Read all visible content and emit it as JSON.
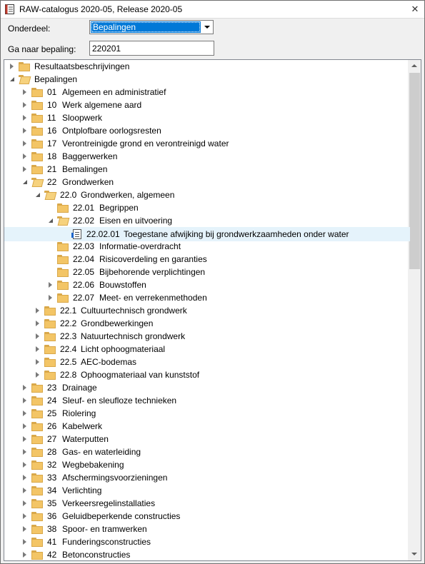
{
  "window": {
    "title": "RAW-catalogus 2020-05, Release 2020-05"
  },
  "form": {
    "onderdeel_label": "Onderdeel:",
    "onderdeel_value": "Bepalingen",
    "ganaar_label": "Ga naar bepaling:",
    "ganaar_value": "220201"
  },
  "tree": [
    {
      "code": "Resultaatsbeschrijvingen",
      "name": "",
      "level": 0,
      "exp": "c",
      "icon": "folder"
    },
    {
      "code": "Bepalingen",
      "name": "",
      "level": 0,
      "exp": "o",
      "icon": "folder-open"
    },
    {
      "code": "01",
      "name": "Algemeen en administratief",
      "level": 1,
      "exp": "c",
      "icon": "folder"
    },
    {
      "code": "10",
      "name": "Werk algemene aard",
      "level": 1,
      "exp": "c",
      "icon": "folder"
    },
    {
      "code": "11",
      "name": "Sloopwerk",
      "level": 1,
      "exp": "c",
      "icon": "folder"
    },
    {
      "code": "16",
      "name": "Ontplofbare oorlogsresten",
      "level": 1,
      "exp": "c",
      "icon": "folder"
    },
    {
      "code": "17",
      "name": "Verontreinigde grond en verontreinigd water",
      "level": 1,
      "exp": "c",
      "icon": "folder"
    },
    {
      "code": "18",
      "name": "Baggerwerken",
      "level": 1,
      "exp": "c",
      "icon": "folder"
    },
    {
      "code": "21",
      "name": "Bemalingen",
      "level": 1,
      "exp": "c",
      "icon": "folder"
    },
    {
      "code": "22",
      "name": "Grondwerken",
      "level": 1,
      "exp": "o",
      "icon": "folder-open"
    },
    {
      "code": "22.0",
      "name": "Grondwerken, algemeen",
      "level": 2,
      "exp": "o",
      "icon": "folder-open"
    },
    {
      "code": "22.01",
      "name": "Begrippen",
      "level": 3,
      "exp": "",
      "icon": "folder"
    },
    {
      "code": "22.02",
      "name": "Eisen en uitvoering",
      "level": 3,
      "exp": "o",
      "icon": "folder-open"
    },
    {
      "code": "22.02.01",
      "name": "Toegestane afwijking bij grondwerkzaamheden onder water",
      "level": 4,
      "exp": "",
      "icon": "doc",
      "selected": true
    },
    {
      "code": "22.03",
      "name": "Informatie-overdracht",
      "level": 3,
      "exp": "",
      "icon": "folder"
    },
    {
      "code": "22.04",
      "name": "Risicoverdeling en garanties",
      "level": 3,
      "exp": "",
      "icon": "folder"
    },
    {
      "code": "22.05",
      "name": "Bijbehorende verplichtingen",
      "level": 3,
      "exp": "",
      "icon": "folder"
    },
    {
      "code": "22.06",
      "name": "Bouwstoffen",
      "level": 3,
      "exp": "c",
      "icon": "folder"
    },
    {
      "code": "22.07",
      "name": "Meet- en verrekenmethoden",
      "level": 3,
      "exp": "c",
      "icon": "folder"
    },
    {
      "code": "22.1",
      "name": "Cultuurtechnisch grondwerk",
      "level": 2,
      "exp": "c",
      "icon": "folder"
    },
    {
      "code": "22.2",
      "name": "Grondbewerkingen",
      "level": 2,
      "exp": "c",
      "icon": "folder"
    },
    {
      "code": "22.3",
      "name": "Natuurtechnisch grondwerk",
      "level": 2,
      "exp": "c",
      "icon": "folder"
    },
    {
      "code": "22.4",
      "name": "Licht ophoogmateriaal",
      "level": 2,
      "exp": "c",
      "icon": "folder"
    },
    {
      "code": "22.5",
      "name": "AEC-bodemas",
      "level": 2,
      "exp": "c",
      "icon": "folder"
    },
    {
      "code": "22.8",
      "name": "Ophoogmateriaal van kunststof",
      "level": 2,
      "exp": "c",
      "icon": "folder"
    },
    {
      "code": "23",
      "name": "Drainage",
      "level": 1,
      "exp": "c",
      "icon": "folder"
    },
    {
      "code": "24",
      "name": "Sleuf- en sleufloze technieken",
      "level": 1,
      "exp": "c",
      "icon": "folder"
    },
    {
      "code": "25",
      "name": "Riolering",
      "level": 1,
      "exp": "c",
      "icon": "folder"
    },
    {
      "code": "26",
      "name": "Kabelwerk",
      "level": 1,
      "exp": "c",
      "icon": "folder"
    },
    {
      "code": "27",
      "name": "Waterputten",
      "level": 1,
      "exp": "c",
      "icon": "folder"
    },
    {
      "code": "28",
      "name": "Gas- en waterleiding",
      "level": 1,
      "exp": "c",
      "icon": "folder"
    },
    {
      "code": "32",
      "name": "Wegbebakening",
      "level": 1,
      "exp": "c",
      "icon": "folder"
    },
    {
      "code": "33",
      "name": "Afschermingsvoorzieningen",
      "level": 1,
      "exp": "c",
      "icon": "folder"
    },
    {
      "code": "34",
      "name": "Verlichting",
      "level": 1,
      "exp": "c",
      "icon": "folder"
    },
    {
      "code": "35",
      "name": "Verkeersregelinstallaties",
      "level": 1,
      "exp": "c",
      "icon": "folder"
    },
    {
      "code": "36",
      "name": "Geluidbeperkende constructies",
      "level": 1,
      "exp": "c",
      "icon": "folder"
    },
    {
      "code": "38",
      "name": "Spoor- en tramwerken",
      "level": 1,
      "exp": "c",
      "icon": "folder"
    },
    {
      "code": "41",
      "name": "Funderingsconstructies",
      "level": 1,
      "exp": "c",
      "icon": "folder"
    },
    {
      "code": "42",
      "name": "Betonconstructies",
      "level": 1,
      "exp": "c",
      "icon": "folder"
    }
  ]
}
